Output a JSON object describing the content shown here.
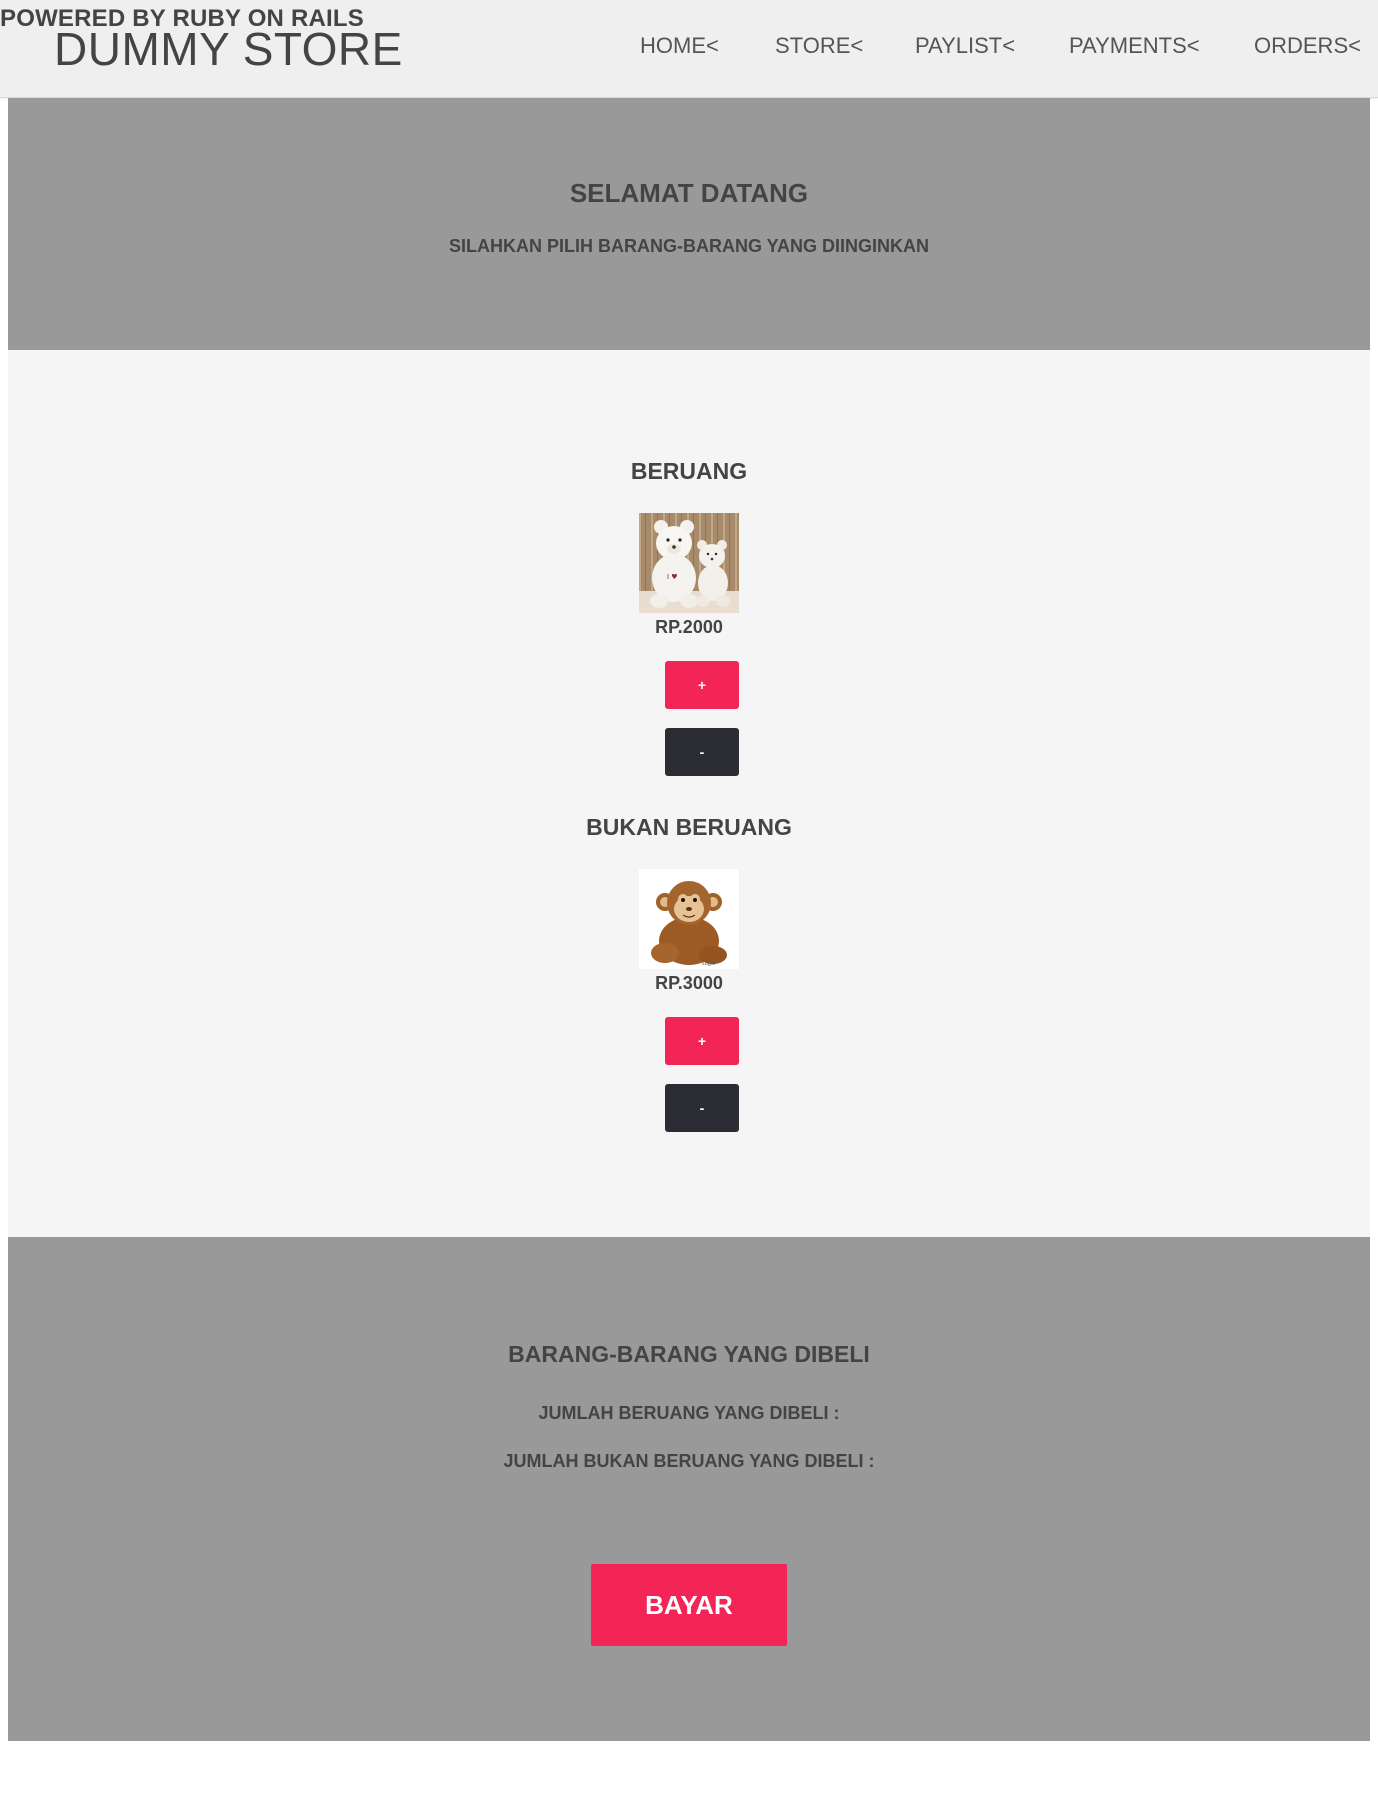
{
  "header": {
    "powered_by": "POWERED BY RUBY ON RAILS",
    "logo": "DUMMY STORE",
    "nav": {
      "home": "HOME<",
      "store": "STORE<",
      "paylist": "PAYLIST<",
      "payments": "PAYMENTS<",
      "orders": "ORDERS<"
    }
  },
  "hero": {
    "title": "SELAMAT DATANG",
    "subtitle": "SILAHKAN PILIH BARANG-BARANG YANG DIINGINKAN"
  },
  "products": [
    {
      "name": "BERUANG",
      "price": "RP.2000",
      "image_icon": "teddy-bear-image",
      "plus_label": "+",
      "minus_label": "-"
    },
    {
      "name": "BUKAN BERUANG",
      "price": "RP.3000",
      "image_icon": "monkey-plush-image",
      "plus_label": "+",
      "minus_label": "-"
    }
  ],
  "summary": {
    "title": "BARANG-BARANG YANG DIBELI",
    "bear_count_label": "JUMLAH BERUANG YANG DIBELI :",
    "non_bear_count_label": "JUMLAH BUKAN BERUANG YANG DIBELI :",
    "pay_label": "BAYAR"
  },
  "colors": {
    "accent": "#f32456",
    "dark_button": "#2c2c34",
    "section_gray": "#999999",
    "content_bg": "#f5f5f5",
    "header_bg": "#efefef",
    "text": "#444444"
  }
}
